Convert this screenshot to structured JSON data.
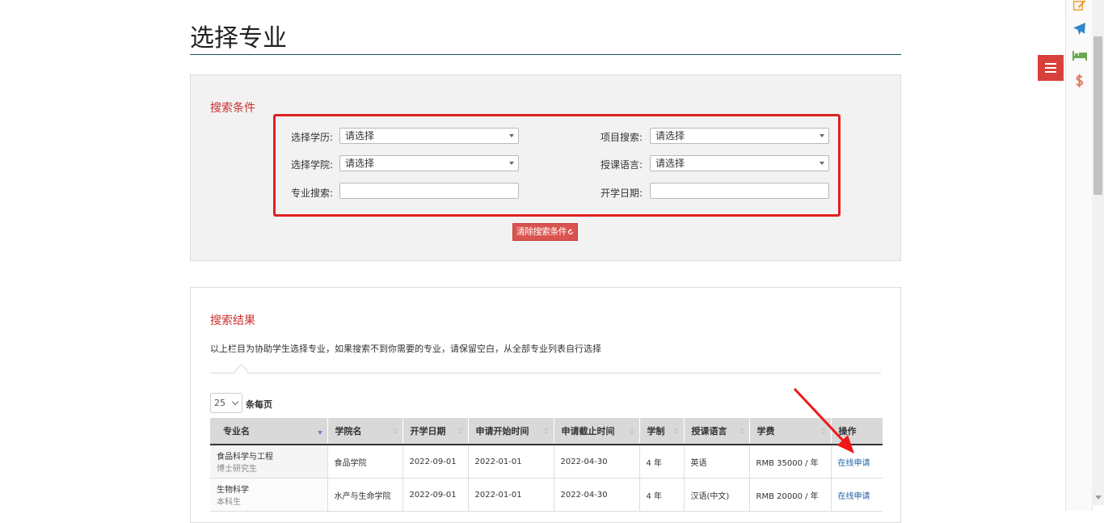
{
  "page": {
    "title": "选择专业"
  },
  "search": {
    "heading": "搜索条件",
    "fields": {
      "education": {
        "label": "选择学历:",
        "value": "请选择"
      },
      "project": {
        "label": "项目搜索:",
        "value": "请选择"
      },
      "college": {
        "label": "选择学院:",
        "value": "请选择"
      },
      "language": {
        "label": "授课语言:",
        "value": "请选择"
      },
      "major": {
        "label": "专业搜索:",
        "value": ""
      },
      "start_date": {
        "label": "开学日期:",
        "value": ""
      }
    },
    "clear_button": "清除搜索条件",
    "clear_icon": "refresh-icon"
  },
  "results": {
    "heading": "搜索结果",
    "note": "以上栏目为协助学生选择专业，如果搜索不到你需要的专业，请保留空白，从全部专业列表自行选择",
    "page_size": "25",
    "page_size_label": "条每页",
    "columns": [
      "专业名",
      "学院名",
      "开学日期",
      "申请开始时间",
      "申请截止时间",
      "学制",
      "授课语言",
      "学费",
      "操作"
    ],
    "rows": [
      {
        "major": "食品科学与工程",
        "degree": "博士研究生",
        "college": "食品学院",
        "start": "2022-09-01",
        "apply_start": "2022-01-01",
        "apply_end": "2022-04-30",
        "duration": "4 年",
        "language": "英语",
        "tuition": "RMB 35000 / 年",
        "action": "在线申请"
      },
      {
        "major": "生物科学",
        "degree": "本科生",
        "college": "水产与生命学院",
        "start": "2022-09-01",
        "apply_start": "2022-01-01",
        "apply_end": "2022-04-30",
        "duration": "4 年",
        "language": "汉语(中文)",
        "tuition": "RMB 20000 / 年",
        "action": "在线申请"
      }
    ]
  },
  "sidebar": {
    "icons": [
      "edit-icon",
      "airplane-icon",
      "bed-icon",
      "dollar-icon"
    ],
    "menu_icon": "hamburger-menu-icon"
  },
  "colors": {
    "accent": "#d9534f",
    "highlight": "#e02020",
    "heading": "#c9302c",
    "link": "#1f5fa8"
  }
}
